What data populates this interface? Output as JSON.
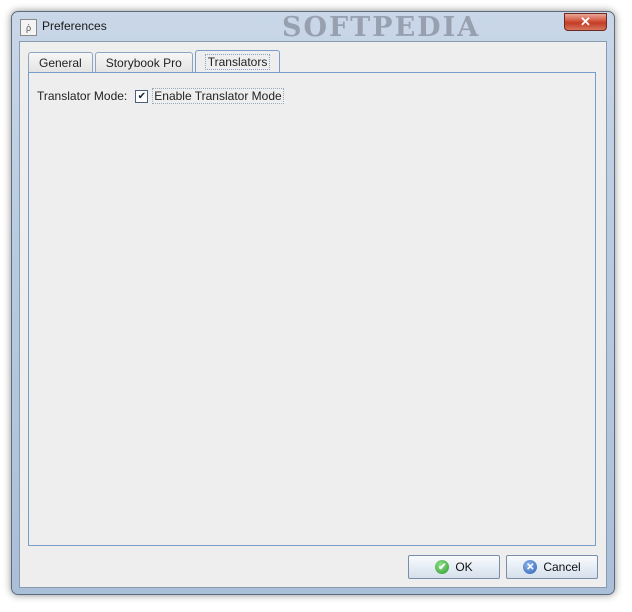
{
  "window": {
    "title": "Preferences",
    "watermark": "SOFTPEDIA",
    "close_glyph": "✕",
    "icon": "app-icon"
  },
  "tabs": [
    {
      "label": "General",
      "active": false
    },
    {
      "label": "Storybook Pro",
      "active": false
    },
    {
      "label": "Translators",
      "active": true
    }
  ],
  "translators": {
    "mode_label": "Translator Mode:",
    "checkbox_label": "Enable Translator Mode",
    "checked": true
  },
  "buttons": {
    "ok_label": "OK",
    "cancel_label": "Cancel"
  },
  "colors": {
    "title_bar": "#b9cbe0",
    "panel": "#eeeeee",
    "close_button": "#c23c25",
    "ok_icon": "#2e9a2a",
    "cancel_icon": "#2c5fb0"
  }
}
